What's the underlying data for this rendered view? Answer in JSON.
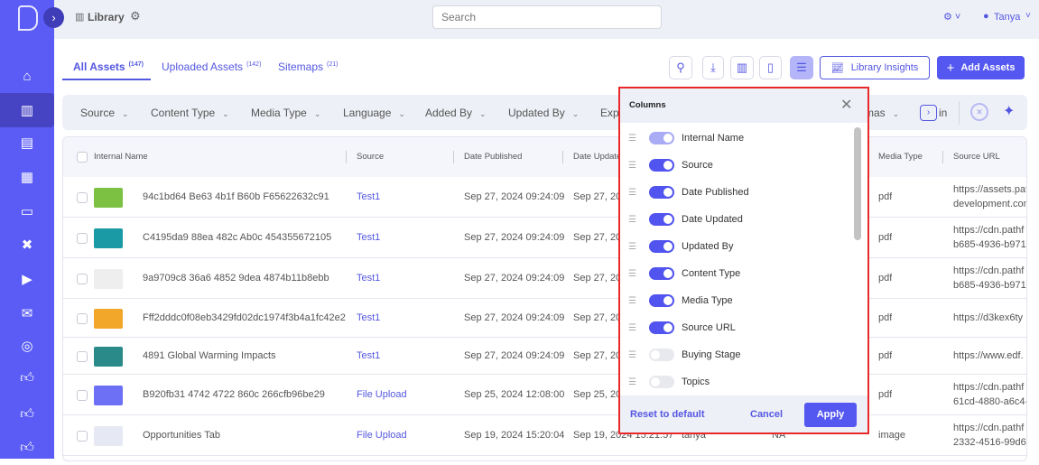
{
  "app": {
    "title": "Library",
    "user": "Tanya",
    "search_placeholder": "Search"
  },
  "colors": {
    "accent": "#5a5cf5",
    "popup_border": "#e8282a"
  },
  "sidebar": {
    "icons": [
      "home-icon",
      "library-icon",
      "dashboard-icon",
      "calendar-icon",
      "browser-icon",
      "tools-icon",
      "video-icon",
      "chat-icon",
      "target-icon",
      "thumbs-up-icon",
      "thumbs-up-icon",
      "thumbs-up-icon"
    ],
    "active": 1
  },
  "tabs": [
    {
      "label": "All Assets",
      "count": "(147)",
      "active": true
    },
    {
      "label": "Uploaded Assets",
      "count": "(142)"
    },
    {
      "label": "Sitemaps",
      "count": "(21)"
    }
  ],
  "toolbar": {
    "insights_label": "Library Insights",
    "add_label": "Add Assets"
  },
  "filters": [
    "Source",
    "Content Type",
    "Media Type",
    "Language",
    "Added By",
    "Updated By",
    "Exp",
    "mas"
  ],
  "filters_more": "in",
  "table": {
    "columns": [
      "Internal Name",
      "Source",
      "Date Published",
      "Date Update",
      "Updated By",
      "Content Type",
      "Media Type",
      "Source URL"
    ],
    "rows": [
      {
        "name": "94c1bd64 Be63 4b1f B60b F65622632c91",
        "source": "Test1",
        "published": "Sep 27, 2024 09:24:09",
        "updated": "Sep 27, 20",
        "by": "",
        "ctype": "",
        "media": "pdf",
        "url": [
          "https://assets.pat",
          "development.com"
        ],
        "thumb": "#7cc142"
      },
      {
        "name": "C4195da9 88ea 482c Ab0c 454355672105",
        "source": "Test1",
        "published": "Sep 27, 2024 09:24:09",
        "updated": "Sep 27, 20",
        "by": "",
        "ctype": "",
        "media": "pdf",
        "url": [
          "https://cdn.pathf",
          "b685-4936-b971-"
        ],
        "thumb": "#1a9aa4"
      },
      {
        "name": "9a9709c8 36a6 4852 9dea 4874b11b8ebb",
        "source": "Test1",
        "published": "Sep 27, 2024 09:24:09",
        "updated": "Sep 27, 20",
        "by": "",
        "ctype": "",
        "media": "pdf",
        "url": [
          "https://cdn.pathf",
          "b685-4936-b971-"
        ],
        "thumb": "#eeeeee"
      },
      {
        "name": "Fff2dddc0f08eb3429fd02dc1974f3b4a1fc42e2",
        "source": "Test1",
        "published": "Sep 27, 2024 09:24:09",
        "updated": "Sep 27, 20",
        "by": "",
        "ctype": "",
        "media": "pdf",
        "url": [
          "https://d3kex6ty"
        ],
        "thumb": "#f2a62a"
      },
      {
        "name": "4891 Global Warming Impacts",
        "source": "Test1",
        "published": "Sep 27, 2024 09:24:09",
        "updated": "Sep 27, 20",
        "by": "",
        "ctype": "",
        "media": "pdf",
        "url": [
          "https://www.edf."
        ],
        "thumb": "#2a8a8a"
      },
      {
        "name": "B920fb31 4742 4722 860c 266cfb96be29",
        "source": "File Upload",
        "published": "Sep 25, 2024 12:08:00",
        "updated": "Sep 25, 20",
        "by": "",
        "ctype": "",
        "media": "pdf",
        "url": [
          "https://cdn.pathf",
          "61cd-4880-a6c4-"
        ],
        "thumb": "#6d6ff5"
      },
      {
        "name": "Opportunities Tab",
        "source": "File Upload",
        "published": "Sep 19, 2024 15:20:04",
        "updated": "Sep 19, 2024 15:21:57",
        "by": "tanya",
        "ctype": "NA",
        "media": "image",
        "url": [
          "https://cdn.pathf",
          "2332-4516-99d6-"
        ],
        "thumb": "#e6e8f4"
      }
    ]
  },
  "columns_popup": {
    "title": "Columns",
    "items": [
      {
        "label": "Internal Name",
        "state": "locked"
      },
      {
        "label": "Source",
        "state": "on"
      },
      {
        "label": "Date Published",
        "state": "on"
      },
      {
        "label": "Date Updated",
        "state": "on"
      },
      {
        "label": "Updated By",
        "state": "on"
      },
      {
        "label": "Content Type",
        "state": "on"
      },
      {
        "label": "Media Type",
        "state": "on"
      },
      {
        "label": "Source URL",
        "state": "on"
      },
      {
        "label": "Buying Stage",
        "state": "off"
      },
      {
        "label": "Topics",
        "state": "off"
      }
    ],
    "reset_label": "Reset to default",
    "cancel_label": "Cancel",
    "apply_label": "Apply"
  }
}
